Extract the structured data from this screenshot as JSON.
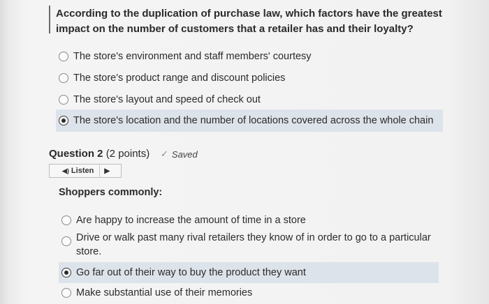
{
  "question1": {
    "text": "According to the duplication of purchase law, which factors have the greatest impact on the number of customers that a retailer has and their loyalty?",
    "options": [
      {
        "label": "The store's environment and staff members' courtesy",
        "selected": false
      },
      {
        "label": "The store's product range and discount policies",
        "selected": false
      },
      {
        "label": "The store's layout and speed of check out",
        "selected": false
      },
      {
        "label": "The store's location and the number of locations covered across the whole chain",
        "selected": true
      }
    ]
  },
  "question2": {
    "title": "Question 2",
    "points": "(2 points)",
    "status": "Saved",
    "status_icon": "check-icon",
    "listen_label": "Listen",
    "text": "Shoppers commonly:",
    "options": [
      {
        "label": "Are happy to increase the amount of time in a store",
        "selected": false
      },
      {
        "label": "Drive or walk past many rival retailers they know of in order to go to a particular store.",
        "selected": false
      },
      {
        "label": "Go far out of their way to buy the product they want",
        "selected": true
      },
      {
        "label": "Make substantial use of their memories",
        "selected": false
      }
    ]
  },
  "colors": {
    "selected_highlight": "#dde3ea",
    "background": "#f2f2f2"
  }
}
